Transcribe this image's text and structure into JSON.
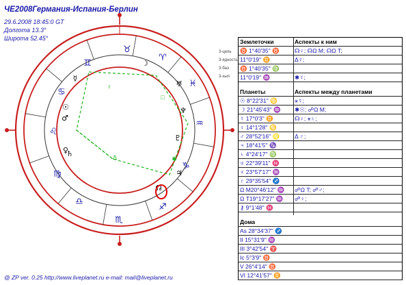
{
  "header": {
    "title": "ЧЕ2008Германия-Испания-Берлин",
    "datetime": "29.6.2008 18:45:0 GT",
    "longitude": "Долгота 13.3°",
    "latitude": "Широта 52.45°"
  },
  "wheel": {
    "zodiac_glyphs": [
      "♈",
      "♉",
      "♊",
      "♋",
      "♌",
      "♍",
      "♎",
      "♏",
      "♐",
      "♑",
      "♒",
      "♓"
    ],
    "planet_glyphs": [
      "☉",
      "☽",
      "☿",
      "♀",
      "♂",
      "♃",
      "♄",
      "♅",
      "♆",
      "♇",
      "☊"
    ],
    "side_labels": [
      "3-цель",
      "3-ядность",
      "3-баэ",
      "3-хып"
    ],
    "colors": {
      "outer_ring": "#c81e1e",
      "aspect_green": "#1db31d",
      "circle_mark": "#e00000"
    }
  },
  "table": {
    "earth_header": "Землеточки",
    "aspects_to_them_header": "Аспекты к ним",
    "earth_rows": [
      [
        "♉ 1°40'35'' ♉",
        "☊♀; ☊Ω M; ☊Ω T;"
      ],
      [
        "11°0'19'' ♊",
        "Δ☿;"
      ],
      [
        "♉ 1°40'35'' ♍",
        ""
      ],
      [
        "11°0'19'' ♒",
        "✱☿;"
      ]
    ],
    "planets_header": "Планеты",
    "aspects_between_header": "Аспекты между планетами",
    "planet_rows": [
      [
        "☉ 8°22'31'' ♋",
        "⚹☿;"
      ],
      [
        "☽ 21°45'43'' ♒",
        "✱☉; ☍Ω M;"
      ],
      [
        "☿ 17°0'3'' ♊",
        "☊♀; ⚹♄;"
      ],
      [
        "♀ 14°1'28'' ♋",
        ""
      ],
      [
        "♂ 28°52'16'' ♌",
        "Δ ♇;"
      ],
      [
        "♃ 18°41'5'' ♑",
        ""
      ],
      [
        "♄ 4°24'17'' ♍",
        ""
      ],
      [
        "♅ 22°39'11'' ♓",
        ""
      ],
      [
        "♆ 23°57'17'' ♒",
        ""
      ],
      [
        "♇ 29°35'54'' ♐",
        ""
      ],
      [
        "Ω M20°46'12'' ♒",
        "☍Ω T; ☍♂;"
      ],
      [
        "Ω T19°17'27'' ♒",
        "☍♀;"
      ],
      [
        "⚷ 9°1'48'' ♓",
        ""
      ]
    ],
    "houses_header": "Дома",
    "house_rows": [
      "As 28°34'37'' ♐",
      "II 15°31'9'' ♒",
      "III 3°42'54'' ♈",
      "Ic 5°3'9'' ♉",
      "V 26°4'14'' ♉",
      "VI 12°41'57'' ♊"
    ]
  },
  "footer": "@ ZP  ver. 0.25 http://www.liveplanet.ru  e-mail: mail@liveplanet.ru"
}
